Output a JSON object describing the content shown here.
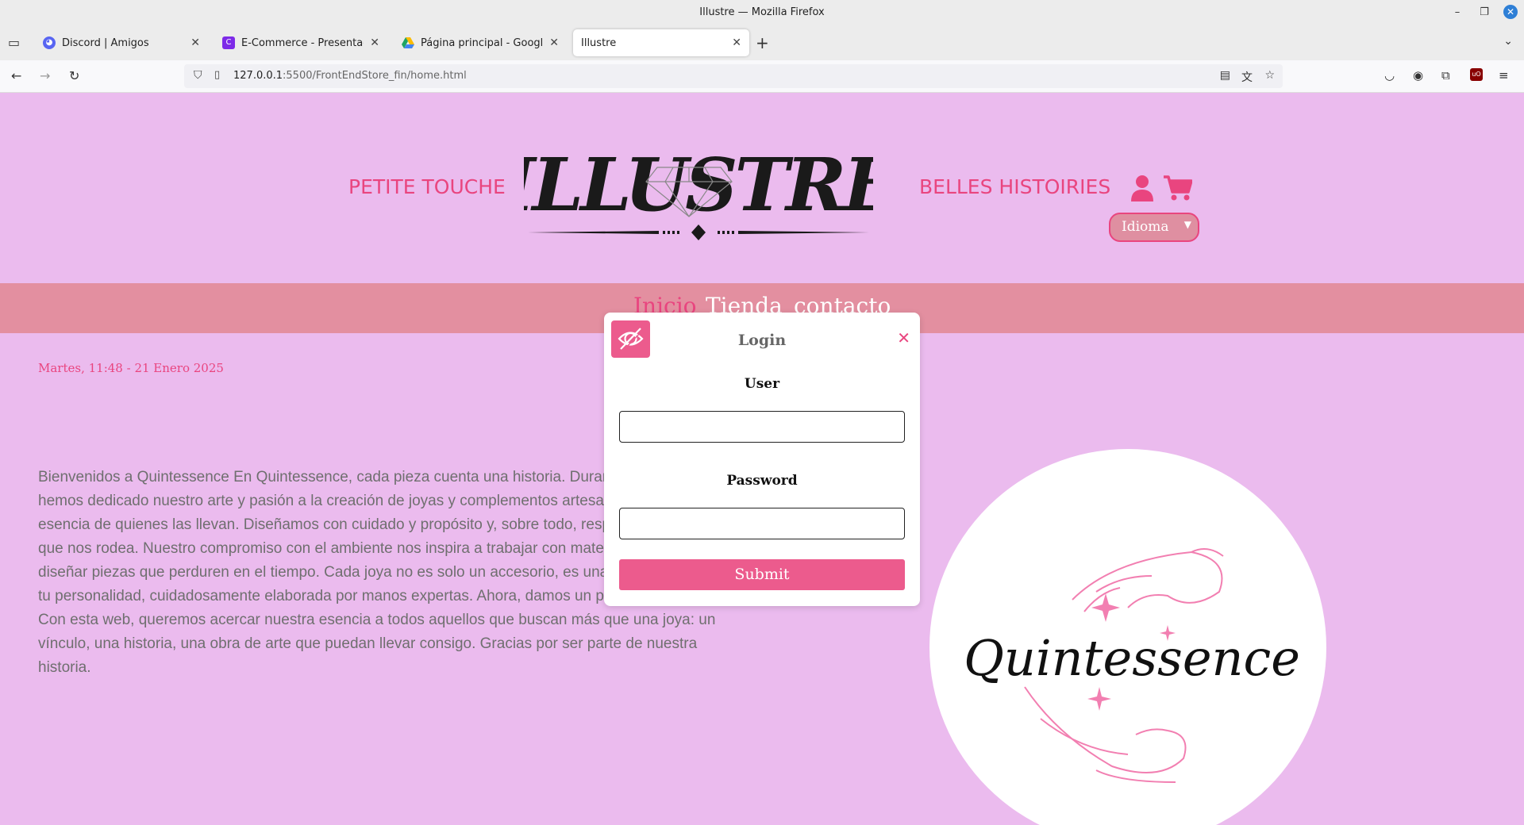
{
  "window": {
    "title": "Illustre — Mozilla Firefox"
  },
  "tabs": [
    {
      "label": "Discord | Amigos",
      "favicon": "discord-icon",
      "color": "#5865f2"
    },
    {
      "label": "E-Commerce - Presentación",
      "favicon": "canva-icon",
      "color": "#7d2ae8"
    },
    {
      "label": "Página principal - Google Dri",
      "favicon": "google-drive-icon",
      "color": "#1fa463"
    },
    {
      "label": "Illustre",
      "favicon": "none",
      "color": "#ffffff"
    }
  ],
  "urlbar": {
    "host": "127.0.0.1",
    "rest": ":5500/FrontEndStore_fin/home.html"
  },
  "header": {
    "left_link": "PETITE TOUCHE",
    "right_link": "BELLES HISTOIRIES",
    "logo_text": "ILLUSTRE",
    "language_select": "Idioma"
  },
  "menu": {
    "items": [
      "Inicio",
      "Tienda",
      "contacto"
    ]
  },
  "main": {
    "date": "Martes, 11:48 - 21 Enero 2025",
    "about_text": "Bienvenidos a Quintessence En Quintessence, cada pieza cuenta una historia. Durante cinco años, hemos dedicado nuestro arte y pasión a la creación de joyas y complementos artesanales que reflejan la esencia de quienes las llevan. Diseñamos con cuidado y propósito y, sobre todo, respetamos el mundo que nos rodea. Nuestro compromiso con el ambiente nos inspira a trabajar con materiales sostenibles y a diseñar piezas que perduren en el tiempo. Cada joya no es solo un accesorio, es una expresión única de tu personalidad, cuidadosamente elaborada por manos expertas. Ahora, damos un paso hacia el futuro. Con esta web, queremos acercar nuestra esencia a todos aquellos que buscan más que una joya: un vínculo, una historia, una obra de arte que puedan llevar consigo. Gracias por ser parte de nuestra historia.",
    "brand_logo_text": "Quintessence"
  },
  "login_modal": {
    "title": "Login",
    "user_label": "User",
    "user_value": "",
    "password_label": "Password",
    "password_value": "",
    "submit_label": "Submit",
    "close_label": "✕"
  },
  "colors": {
    "page_bg": "#ebbbee",
    "accent_pink": "#e9457f",
    "menu_strip": "#e38fa0",
    "button_pink": "#ec5b8d"
  }
}
